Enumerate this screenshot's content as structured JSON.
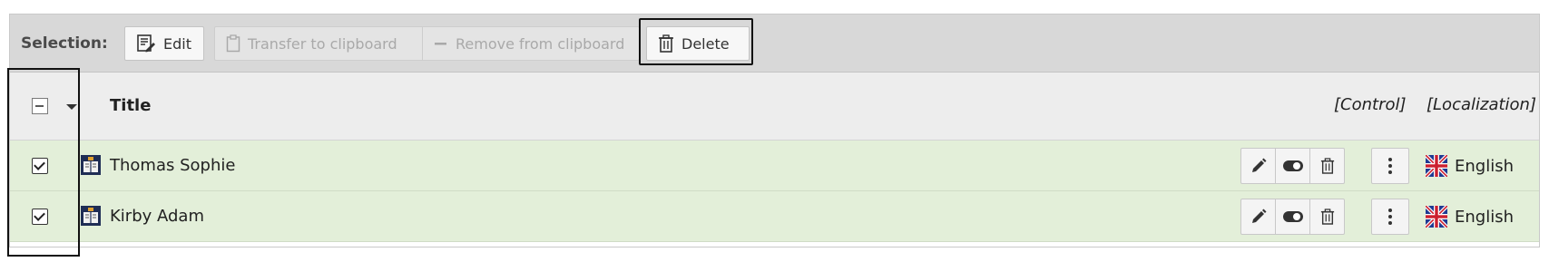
{
  "selection": {
    "label": "Selection:",
    "edit_label": "Edit",
    "transfer_label": "Transfer to clipboard",
    "remove_label": "Remove from clipboard",
    "delete_label": "Delete"
  },
  "table": {
    "header": {
      "title": "Title",
      "control": "[Control]",
      "localization": "[Localization]"
    },
    "rows": [
      {
        "title": "Thomas Sophie",
        "language": "English",
        "checked": true
      },
      {
        "title": "Kirby Adam",
        "language": "English",
        "checked": true
      }
    ]
  },
  "icons": {
    "edit": "edit-document-icon",
    "clipboard": "clipboard-icon",
    "minus": "minus-icon",
    "trash": "trash-icon",
    "pencil": "pencil-icon",
    "toggle": "toggle-icon",
    "more": "more-vertical-icon",
    "flag": "uk-flag-icon",
    "record": "record-type-icon"
  },
  "colors": {
    "selection_bar": "#d8d8d8",
    "header_bg": "#ededed",
    "row_selected_bg": "#e3efd9",
    "disabled_text": "#a9a9a9"
  }
}
